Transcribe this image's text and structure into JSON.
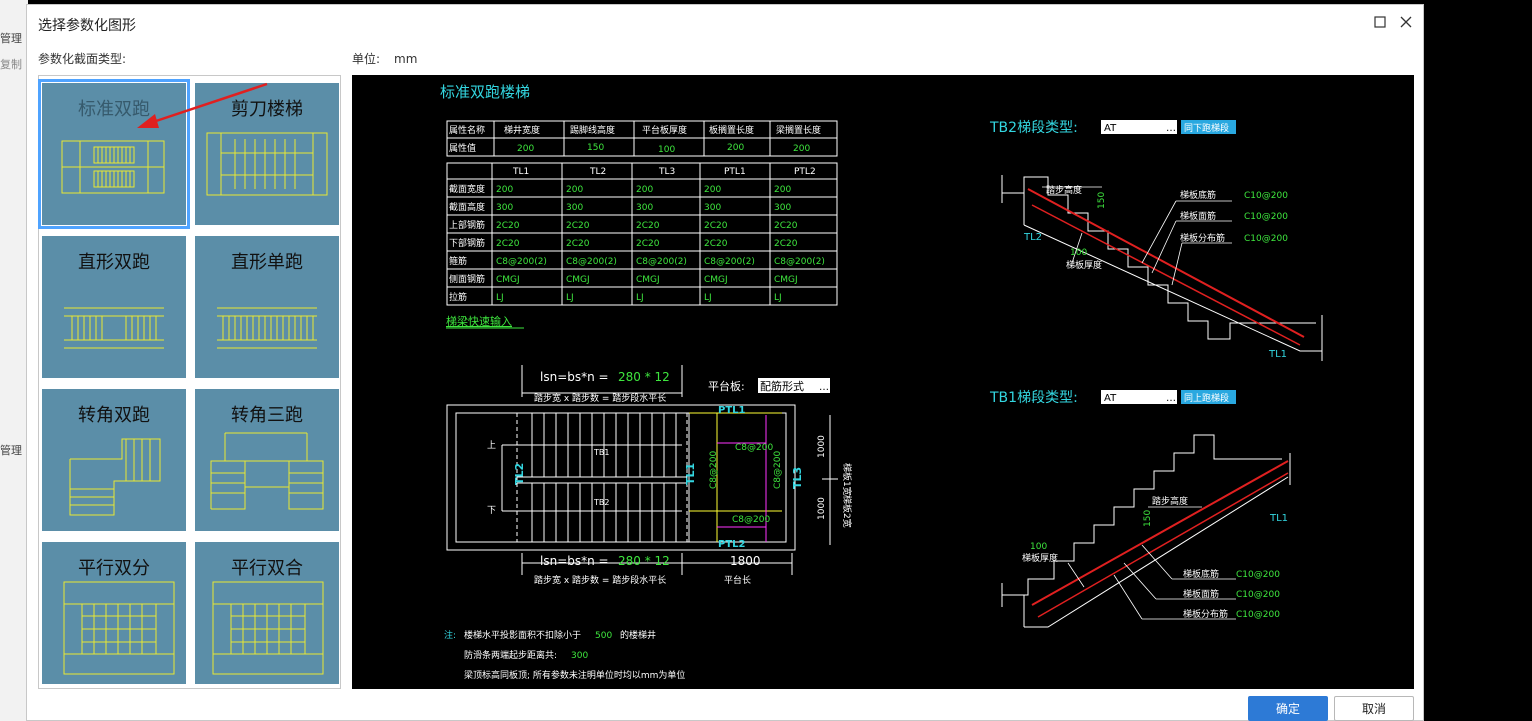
{
  "background": {
    "left_labels": [
      "管理",
      "复制",
      "管理"
    ]
  },
  "dialog": {
    "title": "选择参数化图形",
    "maximize_icon": "maximize-icon",
    "close_icon": "close-icon",
    "section_label": "参数化截面类型:",
    "unit_label": "单位:",
    "unit_value": "mm",
    "ok": "确定",
    "cancel": "取消"
  },
  "tiles": [
    {
      "label": "标准双跑",
      "selected": true
    },
    {
      "label": "剪刀楼梯"
    },
    {
      "label": "直形双跑"
    },
    {
      "label": "直形单跑"
    },
    {
      "label": "转角双跑"
    },
    {
      "label": "转角三跑"
    },
    {
      "label": "平行双分"
    },
    {
      "label": "平行双合"
    }
  ],
  "preview": {
    "title": "标准双跑楼梯",
    "prop_table": {
      "headers": [
        "属性名称",
        "梯井宽度",
        "踢脚线高度",
        "平台板厚度",
        "板搁置长度",
        "梁搁置长度"
      ],
      "row_label": "属性值",
      "values": [
        "200",
        "150",
        "100",
        "200",
        "200"
      ]
    },
    "beam_table": {
      "columns": [
        "TL1",
        "TL2",
        "TL3",
        "PTL1",
        "PTL2"
      ],
      "rows": [
        {
          "label": "截面宽度",
          "values": [
            "200",
            "200",
            "200",
            "200",
            "200"
          ]
        },
        {
          "label": "截面高度",
          "values": [
            "300",
            "300",
            "300",
            "300",
            "300"
          ]
        },
        {
          "label": "上部钢筋",
          "values": [
            "2C20",
            "2C20",
            "2C20",
            "2C20",
            "2C20"
          ]
        },
        {
          "label": "下部钢筋",
          "values": [
            "2C20",
            "2C20",
            "2C20",
            "2C20",
            "2C20"
          ]
        },
        {
          "label": "箍筋",
          "values": [
            "C8@200(2)",
            "C8@200(2)",
            "C8@200(2)",
            "C8@200(2)",
            "C8@200(2)"
          ]
        },
        {
          "label": "侧面钢筋",
          "values": [
            "CMGJ",
            "CMGJ",
            "CMGJ",
            "CMGJ",
            "CMGJ"
          ]
        },
        {
          "label": "拉筋",
          "values": [
            "LJ",
            "LJ",
            "LJ",
            "LJ",
            "LJ"
          ]
        }
      ]
    },
    "quick_input": "梯梁快速输入",
    "plan": {
      "lsn_top": "lsn=bs*n =",
      "lsn_top_val": "280 * 12",
      "lsn_bottom": "lsn=bs*n =",
      "lsn_bottom_val": "280 * 12",
      "dim_note": "踏步宽 x 踏步数 = 踏步段水平长",
      "platform_label": "平台板:",
      "platform_value": "配筋形式",
      "ptl1": "PTL1",
      "ptl2": "PTL2",
      "tl1": "TL1",
      "tl2": "TL2",
      "tl3": "TL3",
      "tb1": "TB1",
      "tb2": "TB2",
      "up": "上",
      "down": "下",
      "rebar_c8": "C8@200",
      "w1": "1000",
      "w2": "1000",
      "w1_label": "梯板1宽",
      "w2_label": "梯板2宽",
      "platform_len": "1800",
      "platform_len_label": "平台长"
    },
    "notes": {
      "prefix": "注:",
      "line1a": "楼梯水平投影面积不扣除小于",
      "line1b": "500",
      "line1c": "的楼梯井",
      "line2a": "防滑条两端起步距离共:",
      "line2b": "300",
      "line3": "梁顶标高同板顶; 所有参数未注明单位时均以mm为单位"
    },
    "tb2": {
      "label": "TB2梯段类型:",
      "value": "AT",
      "button": "同下跑梯段",
      "step_height": "踏步高度",
      "step_val": "150",
      "thick_val": "100",
      "thick_label": "梯板厚度",
      "bottom_rebar": "梯板底筋",
      "bottom_val": "C10@200",
      "face_rebar": "梯板面筋",
      "face_val": "C10@200",
      "dist_rebar": "梯板分布筋",
      "dist_val": "C10@200",
      "tl2": "TL2",
      "tl1": "TL1"
    },
    "tb1": {
      "label": "TB1梯段类型:",
      "value": "AT",
      "button": "同上跑梯段",
      "step_height": "踏步高度",
      "step_val": "150",
      "thick_val": "100",
      "thick_label": "梯板厚度",
      "bottom_rebar": "梯板底筋",
      "bottom_val": "C10@200",
      "face_rebar": "梯板面筋",
      "face_val": "C10@200",
      "dist_rebar": "梯板分布筋",
      "dist_val": "C10@200",
      "tl1": "TL1"
    }
  }
}
